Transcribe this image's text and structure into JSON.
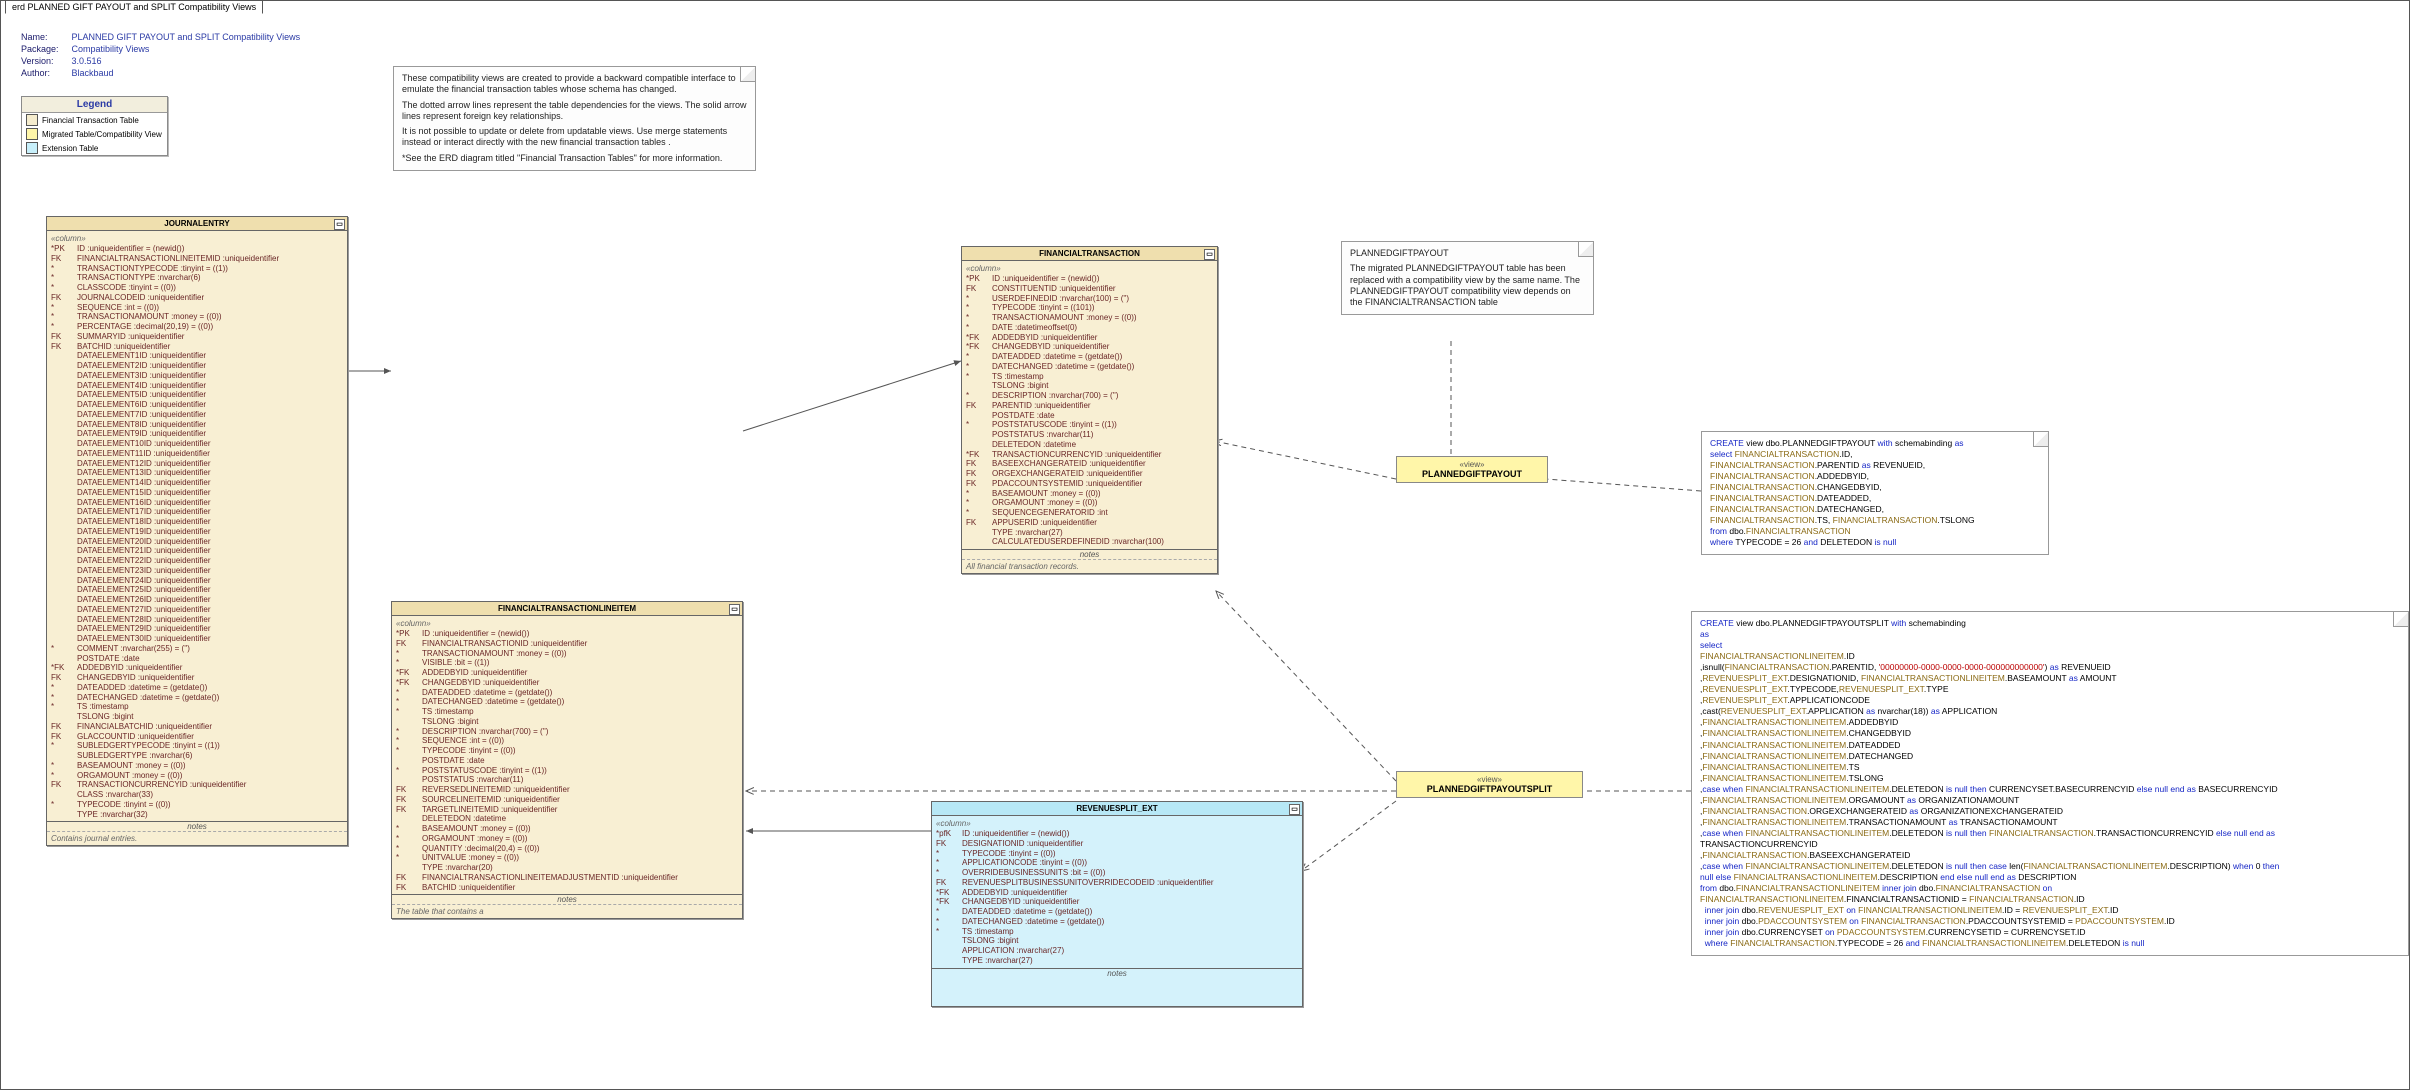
{
  "tab": "erd PLANNED GIFT PAYOUT and SPLIT Compatibility Views",
  "meta": {
    "name_k": "Name:",
    "name_v": "PLANNED GIFT PAYOUT and SPLIT Compatibility Views",
    "package_k": "Package:",
    "package_v": "Compatibility Views",
    "version_k": "Version:",
    "version_v": "3.0.516",
    "author_k": "Author:",
    "author_v": "Blackbaud"
  },
  "legend": {
    "title": "Legend",
    "ft": "Financial Transaction Table",
    "mv": "Migrated Table/Compatibility View",
    "ext": "Extension Table"
  },
  "note_main": {
    "p1": "These compatibility views are created to provide a backward compatible interface to emulate the financial transaction tables whose schema has changed.",
    "p2": "The dotted arrow lines represent the table dependencies for the views. The solid arrow lines represent foreign key relationships.",
    "p3": "It is not possible to update or delete from updatable views.  Use merge statements instead or interact directly with the new financial transaction tables .",
    "p4": "*See the ERD diagram titled \"Financial Transaction Tables\" for more information."
  },
  "note_pgp": {
    "t": "PLANNEDGIFTPAYOUT",
    "b": "The migrated PLANNEDGIFTPAYOUT table has been replaced with a compatibility view by the same name.  The PLANNEDGIFTPAYOUT compatibility view depends on the FINANCIALTRANSACTION table"
  },
  "views": {
    "v1_stereo": "«view»",
    "v1": "PLANNEDGIFTPAYOUT",
    "v2_stereo": "«view»",
    "v2": "PLANNEDGIFTPAYOUTSPLIT"
  },
  "ent_je": {
    "title": "JOURNALENTRY",
    "sec": "«column»",
    "rows": [
      {
        "p": "*PK",
        "t": "ID  :uniqueidentifier = (newid())"
      },
      {
        "p": " FK",
        "t": "FINANCIALTRANSACTIONLINEITEMID  :uniqueidentifier"
      },
      {
        "p": "*",
        "t": "TRANSACTIONTYPECODE  :tinyint = ((1))"
      },
      {
        "p": "*",
        "t": "TRANSACTIONTYPE  :nvarchar(6)"
      },
      {
        "p": "*",
        "t": "CLASSCODE  :tinyint = ((0))"
      },
      {
        "p": " FK",
        "t": "JOURNALCODEID  :uniqueidentifier"
      },
      {
        "p": "*",
        "t": "SEQUENCE  :int = ((0))"
      },
      {
        "p": "*",
        "t": "TRANSACTIONAMOUNT  :money = ((0))"
      },
      {
        "p": "*",
        "t": "PERCENTAGE  :decimal(20,19) = ((0))"
      },
      {
        "p": " FK",
        "t": "SUMMARYID  :uniqueidentifier"
      },
      {
        "p": " FK",
        "t": "BATCHID  :uniqueidentifier"
      },
      {
        "p": "",
        "t": "DATAELEMENT1ID  :uniqueidentifier"
      },
      {
        "p": "",
        "t": "DATAELEMENT2ID  :uniqueidentifier"
      },
      {
        "p": "",
        "t": "DATAELEMENT3ID  :uniqueidentifier"
      },
      {
        "p": "",
        "t": "DATAELEMENT4ID  :uniqueidentifier"
      },
      {
        "p": "",
        "t": "DATAELEMENT5ID  :uniqueidentifier"
      },
      {
        "p": "",
        "t": "DATAELEMENT6ID  :uniqueidentifier"
      },
      {
        "p": "",
        "t": "DATAELEMENT7ID  :uniqueidentifier"
      },
      {
        "p": "",
        "t": "DATAELEMENT8ID  :uniqueidentifier"
      },
      {
        "p": "",
        "t": "DATAELEMENT9ID  :uniqueidentifier"
      },
      {
        "p": "",
        "t": "DATAELEMENT10ID  :uniqueidentifier"
      },
      {
        "p": "",
        "t": "DATAELEMENT11ID  :uniqueidentifier"
      },
      {
        "p": "",
        "t": "DATAELEMENT12ID  :uniqueidentifier"
      },
      {
        "p": "",
        "t": "DATAELEMENT13ID  :uniqueidentifier"
      },
      {
        "p": "",
        "t": "DATAELEMENT14ID  :uniqueidentifier"
      },
      {
        "p": "",
        "t": "DATAELEMENT15ID  :uniqueidentifier"
      },
      {
        "p": "",
        "t": "DATAELEMENT16ID  :uniqueidentifier"
      },
      {
        "p": "",
        "t": "DATAELEMENT17ID  :uniqueidentifier"
      },
      {
        "p": "",
        "t": "DATAELEMENT18ID  :uniqueidentifier"
      },
      {
        "p": "",
        "t": "DATAELEMENT19ID  :uniqueidentifier"
      },
      {
        "p": "",
        "t": "DATAELEMENT20ID  :uniqueidentifier"
      },
      {
        "p": "",
        "t": "DATAELEMENT21ID  :uniqueidentifier"
      },
      {
        "p": "",
        "t": "DATAELEMENT22ID  :uniqueidentifier"
      },
      {
        "p": "",
        "t": "DATAELEMENT23ID  :uniqueidentifier"
      },
      {
        "p": "",
        "t": "DATAELEMENT24ID  :uniqueidentifier"
      },
      {
        "p": "",
        "t": "DATAELEMENT25ID  :uniqueidentifier"
      },
      {
        "p": "",
        "t": "DATAELEMENT26ID  :uniqueidentifier"
      },
      {
        "p": "",
        "t": "DATAELEMENT27ID  :uniqueidentifier"
      },
      {
        "p": "",
        "t": "DATAELEMENT28ID  :uniqueidentifier"
      },
      {
        "p": "",
        "t": "DATAELEMENT29ID  :uniqueidentifier"
      },
      {
        "p": "",
        "t": "DATAELEMENT30ID  :uniqueidentifier"
      },
      {
        "p": "*",
        "t": "COMMENT  :nvarchar(255) = ('')"
      },
      {
        "p": "",
        "t": "POSTDATE  :date"
      },
      {
        "p": "*FK",
        "t": "ADDEDBYID  :uniqueidentifier"
      },
      {
        "p": " FK",
        "t": "CHANGEDBYID  :uniqueidentifier"
      },
      {
        "p": "*",
        "t": "DATEADDED  :datetime = (getdate())"
      },
      {
        "p": "*",
        "t": "DATECHANGED  :datetime = (getdate())"
      },
      {
        "p": "*",
        "t": "TS  :timestamp"
      },
      {
        "p": "",
        "t": "TSLONG  :bigint"
      },
      {
        "p": " FK",
        "t": "FINANCIALBATCHID  :uniqueidentifier"
      },
      {
        "p": " FK",
        "t": "GLACCOUNTID  :uniqueidentifier"
      },
      {
        "p": "*",
        "t": "SUBLEDGERTYPECODE  :tinyint = ((1))"
      },
      {
        "p": "",
        "t": "SUBLEDGERTYPE  :nvarchar(6)"
      },
      {
        "p": "*",
        "t": "BASEAMOUNT  :money = ((0))"
      },
      {
        "p": "*",
        "t": "ORGAMOUNT  :money = ((0))"
      },
      {
        "p": " FK",
        "t": "TRANSACTIONCURRENCYID  :uniqueidentifier"
      },
      {
        "p": "",
        "t": "CLASS  :nvarchar(33)"
      },
      {
        "p": "*",
        "t": "TYPECODE  :tinyint = ((0))"
      },
      {
        "p": "",
        "t": "TYPE  :nvarchar(32)"
      }
    ],
    "notes_label": "notes",
    "notes_body": "Contains journal entries."
  },
  "ent_ftli": {
    "title": "FINANCIALTRANSACTIONLINEITEM",
    "sec": "«column»",
    "rows": [
      {
        "p": "*PK",
        "t": "ID  :uniqueidentifier = (newid())"
      },
      {
        "p": " FK",
        "t": "FINANCIALTRANSACTIONID  :uniqueidentifier"
      },
      {
        "p": "*",
        "t": "TRANSACTIONAMOUNT  :money = ((0))"
      },
      {
        "p": "*",
        "t": "VISIBLE  :bit = ((1))"
      },
      {
        "p": "*FK",
        "t": "ADDEDBYID  :uniqueidentifier"
      },
      {
        "p": "*FK",
        "t": "CHANGEDBYID  :uniqueidentifier"
      },
      {
        "p": "*",
        "t": "DATEADDED  :datetime = (getdate())"
      },
      {
        "p": "*",
        "t": "DATECHANGED  :datetime = (getdate())"
      },
      {
        "p": "*",
        "t": "TS  :timestamp"
      },
      {
        "p": "",
        "t": "TSLONG  :bigint"
      },
      {
        "p": "*",
        "t": "DESCRIPTION  :nvarchar(700) = ('')"
      },
      {
        "p": "*",
        "t": "SEQUENCE  :int = ((0))"
      },
      {
        "p": "*",
        "t": "TYPECODE  :tinyint = ((0))"
      },
      {
        "p": "",
        "t": "POSTDATE  :date"
      },
      {
        "p": "*",
        "t": "POSTSTATUSCODE  :tinyint = ((1))"
      },
      {
        "p": "",
        "t": "POSTSTATUS  :nvarchar(11)"
      },
      {
        "p": " FK",
        "t": "REVERSEDLINEITEMID  :uniqueidentifier"
      },
      {
        "p": " FK",
        "t": "SOURCELINEITEMID  :uniqueidentifier"
      },
      {
        "p": " FK",
        "t": "TARGETLINEITEMID  :uniqueidentifier"
      },
      {
        "p": "",
        "t": "DELETEDON  :datetime"
      },
      {
        "p": "*",
        "t": "BASEAMOUNT  :money = ((0))"
      },
      {
        "p": "*",
        "t": "ORGAMOUNT  :money = ((0))"
      },
      {
        "p": "*",
        "t": "QUANTITY  :decimal(20,4) = ((0))"
      },
      {
        "p": "*",
        "t": "UNITVALUE  :money = ((0))"
      },
      {
        "p": "",
        "t": "TYPE  :nvarchar(20)"
      },
      {
        "p": " FK",
        "t": "FINANCIALTRANSACTIONLINEITEMADJUSTMENTID  :uniqueidentifier"
      },
      {
        "p": " FK",
        "t": "BATCHID  :uniqueidentifier"
      }
    ],
    "notes_label": "notes",
    "notes_body": "The table that contains a"
  },
  "ent_ft": {
    "title": "FINANCIALTRANSACTION",
    "sec": "«column»",
    "rows": [
      {
        "p": "*PK",
        "t": "ID  :uniqueidentifier = (newid())"
      },
      {
        "p": " FK",
        "t": "CONSTITUENTID  :uniqueidentifier"
      },
      {
        "p": "*",
        "t": "USERDEFINEDID  :nvarchar(100) = ('')"
      },
      {
        "p": "*",
        "t": "TYPECODE  :tinyint = ((101))"
      },
      {
        "p": "*",
        "t": "TRANSACTIONAMOUNT  :money = ((0))"
      },
      {
        "p": "*",
        "t": "DATE  :datetimeoffset(0)"
      },
      {
        "p": "*FK",
        "t": "ADDEDBYID  :uniqueidentifier"
      },
      {
        "p": "*FK",
        "t": "CHANGEDBYID  :uniqueidentifier"
      },
      {
        "p": "*",
        "t": "DATEADDED  :datetime = (getdate())"
      },
      {
        "p": "*",
        "t": "DATECHANGED  :datetime = (getdate())"
      },
      {
        "p": "*",
        "t": "TS  :timestamp"
      },
      {
        "p": "",
        "t": "TSLONG  :bigint"
      },
      {
        "p": "*",
        "t": "DESCRIPTION  :nvarchar(700) = ('')"
      },
      {
        "p": " FK",
        "t": "PARENTID  :uniqueidentifier"
      },
      {
        "p": "",
        "t": "POSTDATE  :date"
      },
      {
        "p": "*",
        "t": "POSTSTATUSCODE  :tinyint = ((1))"
      },
      {
        "p": "",
        "t": "POSTSTATUS  :nvarchar(11)"
      },
      {
        "p": "",
        "t": "DELETEDON  :datetime"
      },
      {
        "p": "*FK",
        "t": "TRANSACTIONCURRENCYID  :uniqueidentifier"
      },
      {
        "p": " FK",
        "t": "BASEEXCHANGERATEID  :uniqueidentifier"
      },
      {
        "p": " FK",
        "t": "ORGEXCHANGERATEID  :uniqueidentifier"
      },
      {
        "p": " FK",
        "t": "PDACCOUNTSYSTEMID  :uniqueidentifier"
      },
      {
        "p": "*",
        "t": "BASEAMOUNT  :money = ((0))"
      },
      {
        "p": "*",
        "t": "ORGAMOUNT  :money = ((0))"
      },
      {
        "p": "*",
        "t": "SEQUENCEGENERATORID  :int"
      },
      {
        "p": " FK",
        "t": "APPUSERID  :uniqueidentifier"
      },
      {
        "p": "",
        "t": "TYPE  :nvarchar(27)"
      },
      {
        "p": "",
        "t": "CALCULATEDUSERDEFINEDID  :nvarchar(100)"
      }
    ],
    "notes_label": "notes",
    "notes_body": "All financial transaction records."
  },
  "ent_rse": {
    "title": "REVENUESPLIT_EXT",
    "sec": "«column»",
    "rows": [
      {
        "p": "*pfK",
        "t": "ID  :uniqueidentifier = (newid())"
      },
      {
        "p": " FK",
        "t": "DESIGNATIONID  :uniqueidentifier"
      },
      {
        "p": "*",
        "t": "TYPECODE  :tinyint = ((0))"
      },
      {
        "p": "*",
        "t": "APPLICATIONCODE  :tinyint = ((0))"
      },
      {
        "p": "*",
        "t": "OVERRIDEBUSINESSUNITS  :bit = ((0))"
      },
      {
        "p": " FK",
        "t": "REVENUESPLITBUSINESSUNITOVERRIDECODEID  :uniqueidentifier"
      },
      {
        "p": "*FK",
        "t": "ADDEDBYID  :uniqueidentifier"
      },
      {
        "p": "*FK",
        "t": "CHANGEDBYID  :uniqueidentifier"
      },
      {
        "p": "*",
        "t": "DATEADDED  :datetime = (getdate())"
      },
      {
        "p": "*",
        "t": "DATECHANGED  :datetime = (getdate())"
      },
      {
        "p": "*",
        "t": "TS  :timestamp"
      },
      {
        "p": "",
        "t": "TSLONG  :bigint"
      },
      {
        "p": "",
        "t": "APPLICATION  :nvarchar(27)"
      },
      {
        "p": "",
        "t": "TYPE  :nvarchar(27)"
      }
    ],
    "notes_label": "notes"
  },
  "sql1": {
    "l1a": "CREATE",
    "l1b": " view dbo.PLANNEDGIFTPAYOUT ",
    "l1c": "with",
    "l1d": " schemabinding ",
    "l1e": "as",
    "l2a": "select ",
    "l2b": "FINANCIALTRANSACTION",
    "l2c": ".ID,",
    "l3a": "FINANCIALTRANSACTION",
    "l3b": ".PARENTID ",
    "l3c": "as",
    "l3d": " REVENUEID,",
    "l4a": "FINANCIALTRANSACTION",
    "l4b": ".ADDEDBYID,",
    "l5a": "FINANCIALTRANSACTION",
    "l5b": ".CHANGEDBYID,",
    "l6a": "FINANCIALTRANSACTION",
    "l6b": ".DATEADDED,",
    "l7a": "FINANCIALTRANSACTION",
    "l7b": ".DATECHANGED,",
    "l8a": "FINANCIALTRANSACTION",
    "l8b": ".TS, ",
    "l8c": "FINANCIALTRANSACTION",
    "l8d": ".TSLONG",
    "l9a": "from",
    "l9b": " dbo.",
    "l9c": "FINANCIALTRANSACTION",
    "l10a": "where",
    "l10b": " TYPECODE = 26 ",
    "l10c": "and",
    "l10d": " DELETEDON ",
    "l10e": "is null"
  },
  "sql2": {
    "l1a": "CREATE",
    "l1b": " view dbo.PLANNEDGIFTPAYOUTSPLIT ",
    "l1c": "with",
    "l1d": " schemabinding",
    "l2": "as",
    "l3": "select",
    "l4a": "FINANCIALTRANSACTIONLINEITEM",
    "l4b": ".ID",
    "l5a": ",isnull(",
    "l5b": "FINANCIALTRANSACTION",
    "l5c": ".PARENTID, ",
    "l5d": "'00000000-0000-0000-0000-000000000000'",
    "l5e": ") ",
    "l5f": "as",
    "l5g": " REVENUEID",
    "l6a": ",",
    "l6b": "REVENUESPLIT_EXT",
    "l6c": ".DESIGNATIONID, ",
    "l6d": "FINANCIALTRANSACTIONLINEITEM",
    "l6e": ".BASEAMOUNT ",
    "l6f": "as",
    "l6g": " AMOUNT",
    "l7a": ",",
    "l7b": "REVENUESPLIT_EXT",
    "l7c": ".TYPECODE,",
    "l7d": "REVENUESPLIT_EXT",
    "l7e": ".TYPE",
    "l8a": ",",
    "l8b": "REVENUESPLIT_EXT",
    "l8c": ".APPLICATIONCODE",
    "l9a": ",cast(",
    "l9b": "REVENUESPLIT_EXT",
    "l9c": ".APPLICATION ",
    "l9d": "as",
    "l9e": " nvarchar(18)) ",
    "l9f": "as",
    "l9g": " APPLICATION",
    "l10a": ",",
    "l10b": "FINANCIALTRANSACTIONLINEITEM",
    "l10c": ".ADDEDBYID",
    "l11a": ",",
    "l11b": "FINANCIALTRANSACTIONLINEITEM",
    "l11c": ".CHANGEDBYID",
    "l12a": ",",
    "l12b": "FINANCIALTRANSACTIONLINEITEM",
    "l12c": ".DATEADDED",
    "l13a": ",",
    "l13b": "FINANCIALTRANSACTIONLINEITEM",
    "l13c": ".DATECHANGED",
    "l14a": ",",
    "l14b": "FINANCIALTRANSACTIONLINEITEM",
    "l14c": ".TS",
    "l15a": ",",
    "l15b": "FINANCIALTRANSACTIONLINEITEM",
    "l15c": ".TSLONG",
    "l16a": ",",
    "l16b": "case when ",
    "l16c": "FINANCIALTRANSACTIONLINEITEM",
    "l16d": ".DELETEDON ",
    "l16e": "is null then",
    "l16f": " CURRENCYSET.BASECURRENCYID ",
    "l16g": "else null end as",
    "l16h": " BASECURRENCYID",
    "l17a": ",",
    "l17b": "FINANCIALTRANSACTIONLINEITEM",
    "l17c": ".ORGAMOUNT ",
    "l17d": "as",
    "l17e": " ORGANIZATIONAMOUNT",
    "l18a": ",",
    "l18b": "FINANCIALTRANSACTION",
    "l18c": ".ORGEXCHANGERATEID ",
    "l18d": "as",
    "l18e": " ORGANIZATIONEXCHANGERATEID",
    "l19a": ",",
    "l19b": "FINANCIALTRANSACTIONLINEITEM",
    "l19c": ".TRANSACTIONAMOUNT ",
    "l19d": "as",
    "l19e": " TRANSACTIONAMOUNT",
    "l20a": ",",
    "l20b": "case when ",
    "l20c": "FINANCIALTRANSACTIONLINEITEM",
    "l20d": ".DELETEDON ",
    "l20e": "is null then ",
    "l20f": "FINANCIALTRANSACTION",
    "l20g": ".TRANSACTIONCURRENCYID ",
    "l20h": "else null end as",
    "l21": "TRANSACTIONCURRENCYID",
    "l22a": ",",
    "l22b": "FINANCIALTRANSACTION",
    "l22c": ".BASEEXCHANGERATEID",
    "l23a": ",",
    "l23b": "case when ",
    "l23c": "FINANCIALTRANSACTIONLINEITEM",
    "l23d": ".DELETEDON ",
    "l23e": "is null then case",
    "l23f": " len(",
    "l23g": "FINANCIALTRANSACTIONLINEITEM",
    "l23h": ".DESCRIPTION) ",
    "l23i": "when",
    "l23j": " 0 ",
    "l23k": "then",
    "l24a": "null else ",
    "l24b": "FINANCIALTRANSACTIONLINEITEM",
    "l24c": ".DESCRIPTION ",
    "l24d": "end  else null end as",
    "l24e": " DESCRIPTION",
    "l25a": "from",
    "l25b": " dbo.",
    "l25c": "FINANCIALTRANSACTIONLINEITEM",
    "l25d": " inner join",
    "l25e": " dbo.",
    "l25f": "FINANCIALTRANSACTION",
    "l25g": " on",
    "l26a": "FINANCIALTRANSACTIONLINEITEM",
    "l26b": ".FINANCIALTRANSACTIONID = ",
    "l26c": "FINANCIALTRANSACTION",
    "l26d": ".ID",
    "l27a": "inner join",
    "l27b": " dbo.",
    "l27c": "REVENUESPLIT_EXT",
    "l27d": " on ",
    "l27e": "FINANCIALTRANSACTIONLINEITEM",
    "l27f": ".ID = ",
    "l27g": "REVENUESPLIT_EXT",
    "l27h": ".ID",
    "l28a": "inner join",
    "l28b": " dbo.",
    "l28c": "PDACCOUNTSYSTEM",
    "l28d": " on ",
    "l28e": "FINANCIALTRANSACTION",
    "l28f": ".PDACCOUNTSYSTEMID = ",
    "l28g": "PDACCOUNTSYSTEM",
    "l28h": ".ID",
    "l29a": "inner join",
    "l29b": " dbo.CURRENCYSET ",
    "l29c": "on ",
    "l29d": "PDACCOUNTSYSTEM",
    "l29e": ".CURRENCYSETID = CURRENCYSET.ID",
    "l30a": "where ",
    "l30b": "FINANCIALTRANSACTION",
    "l30c": ".TYPECODE = 26  ",
    "l30d": "and ",
    "l30e": "FINANCIALTRANSACTIONLINEITEM",
    "l30f": ".DELETEDON ",
    "l30g": "is null"
  }
}
